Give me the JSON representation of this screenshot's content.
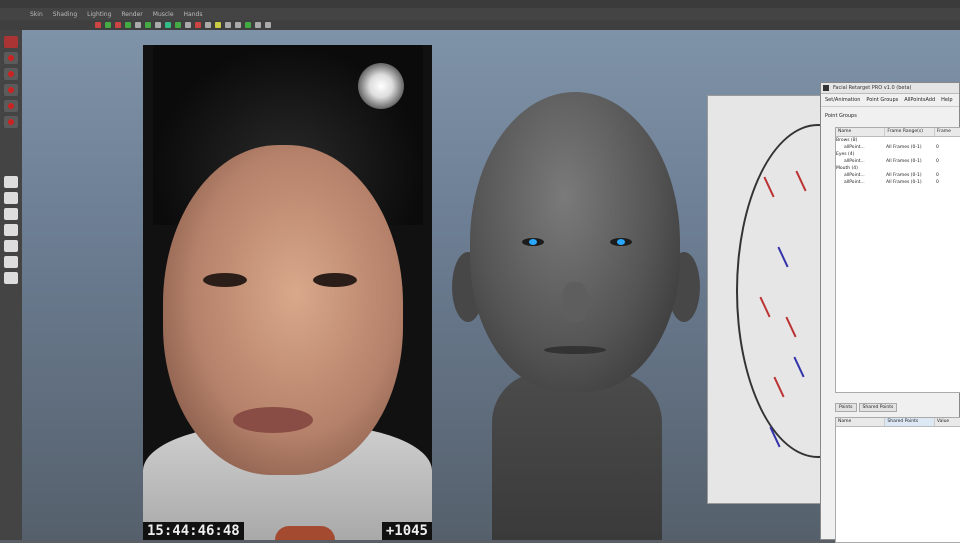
{
  "app": {
    "menu": [
      "Skin",
      "Shading",
      "Lighting",
      "Render",
      "Muscle",
      "Hands"
    ]
  },
  "video": {
    "timecode": "15:44:46:48",
    "frame": "+1045"
  },
  "plugin": {
    "title": "Facial Retarget PRO v1.0 (beta)",
    "menu": [
      "Set/Animation",
      "Point Groups",
      "AllPointsAdd",
      "Help"
    ],
    "section": "Point Groups",
    "columns": [
      "Name",
      "Frame Range(s)",
      "Frame"
    ],
    "rows": [
      {
        "name": "Brows (8)",
        "range": "",
        "frame": ""
      },
      {
        "name": "allPoint...",
        "range": "All Frames (0-1)",
        "frame": "0"
      },
      {
        "name": "Eyes (4)",
        "range": "",
        "frame": ""
      },
      {
        "name": "allPoint...",
        "range": "All Frames (0-1)",
        "frame": "0"
      },
      {
        "name": "Mouth (4)",
        "range": "",
        "frame": ""
      },
      {
        "name": "allPoint...",
        "range": "All Frames (0-1)",
        "frame": "0"
      },
      {
        "name": "allPoint...",
        "range": "All Frames (0-1)",
        "frame": "0"
      }
    ],
    "tabs": [
      "Points",
      "Shared Points"
    ],
    "list_columns": [
      "Name",
      "Shared Points",
      "Value"
    ]
  }
}
